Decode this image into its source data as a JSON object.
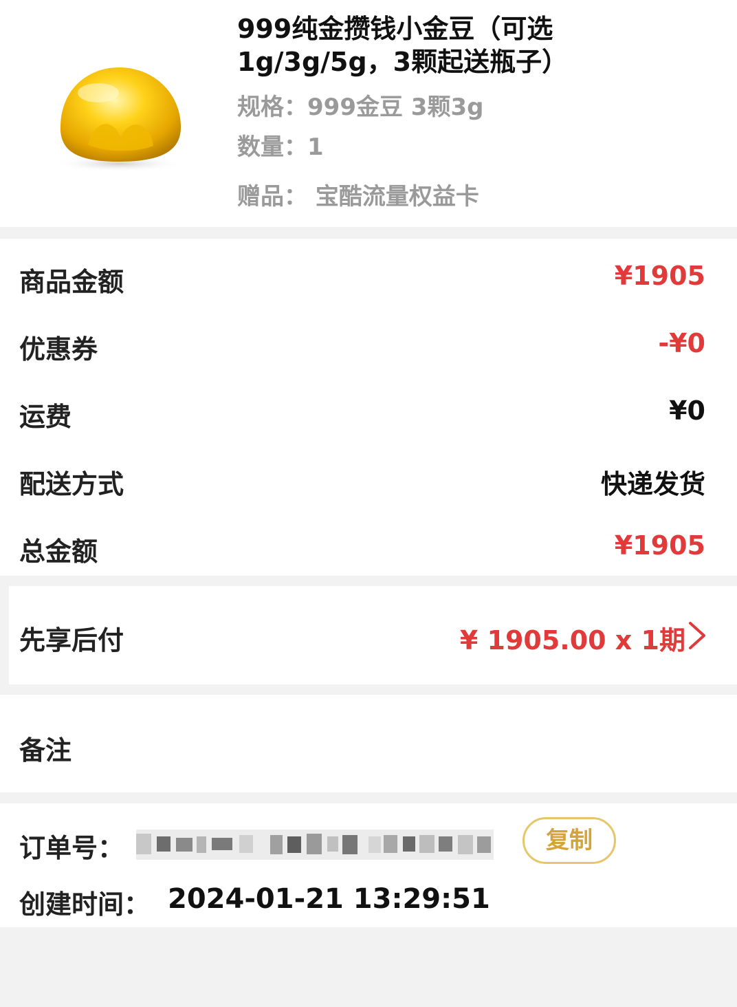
{
  "product": {
    "title_line1": "999纯金攒钱小金豆（可选",
    "title_line2": "1g/3g/5g，3颗起送瓶子）",
    "spec": "规格：999金豆 3颗3g",
    "quantity": "数量：1",
    "gift": "赠品：  宝酷流量权益卡",
    "image_icon": "gold-bean-image"
  },
  "summary": {
    "rows": [
      {
        "label": "商品金额",
        "value": "¥1905",
        "color": "#e03a3a"
      },
      {
        "label": "优惠券",
        "value": "-¥0",
        "color": "#e03a3a"
      },
      {
        "label": "运费",
        "value": "¥0",
        "color": "#111111"
      },
      {
        "label": "配送方式",
        "value": "快递发货",
        "color": "#111111"
      },
      {
        "label": "总金额",
        "value": "¥1905",
        "color": "#e03a3a"
      }
    ]
  },
  "payment": {
    "label": "先享后付",
    "value": "¥ 1905.00 x 1期",
    "icon": "chevron-right-icon"
  },
  "remark": {
    "label": "备注"
  },
  "order": {
    "number_label": "订单号：",
    "copy_label": "复制",
    "created_label": "创建时间：",
    "created_time": "2024-01-21 13:29:51"
  },
  "colors": {
    "accent_red": "#e03a3a",
    "copy_gold": "#d4a43a",
    "background": "#f2f2f2"
  }
}
